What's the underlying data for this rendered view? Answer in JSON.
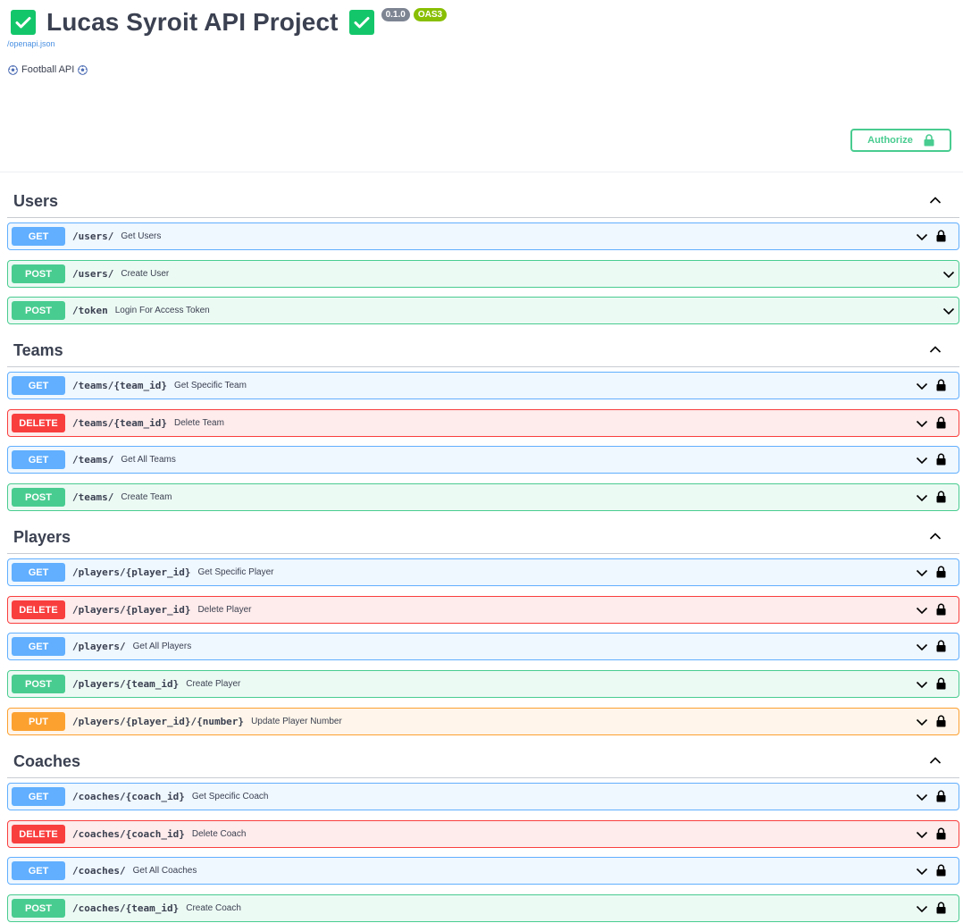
{
  "info": {
    "title": "Lucas Syroit API Project",
    "version_badge": "0.1.0",
    "oas_badge": "OAS3",
    "spec_link": "/openapi.json",
    "description": "Football API"
  },
  "authorize": {
    "label": "Authorize"
  },
  "colors": {
    "get": "#61affe",
    "post": "#49cc90",
    "delete": "#f93e3e",
    "put": "#fca130",
    "check": "#14c66a"
  },
  "tags": [
    {
      "name": "Users",
      "operations": [
        {
          "method": "GET",
          "path": "/users/",
          "summary": "Get Users",
          "locked": true
        },
        {
          "method": "POST",
          "path": "/users/",
          "summary": "Create User",
          "locked": false
        },
        {
          "method": "POST",
          "path": "/token",
          "summary": "Login For Access Token",
          "locked": false
        }
      ]
    },
    {
      "name": "Teams",
      "operations": [
        {
          "method": "GET",
          "path": "/teams/{team_id}",
          "summary": "Get Specific Team",
          "locked": true
        },
        {
          "method": "DELETE",
          "path": "/teams/{team_id}",
          "summary": "Delete Team",
          "locked": true
        },
        {
          "method": "GET",
          "path": "/teams/",
          "summary": "Get All Teams",
          "locked": true
        },
        {
          "method": "POST",
          "path": "/teams/",
          "summary": "Create Team",
          "locked": true
        }
      ]
    },
    {
      "name": "Players",
      "operations": [
        {
          "method": "GET",
          "path": "/players/{player_id}",
          "summary": "Get Specific Player",
          "locked": true
        },
        {
          "method": "DELETE",
          "path": "/players/{player_id}",
          "summary": "Delete Player",
          "locked": true
        },
        {
          "method": "GET",
          "path": "/players/",
          "summary": "Get All Players",
          "locked": true
        },
        {
          "method": "POST",
          "path": "/players/{team_id}",
          "summary": "Create Player",
          "locked": true
        },
        {
          "method": "PUT",
          "path": "/players/{player_id}/{number}",
          "summary": "Update Player Number",
          "locked": true
        }
      ]
    },
    {
      "name": "Coaches",
      "operations": [
        {
          "method": "GET",
          "path": "/coaches/{coach_id}",
          "summary": "Get Specific Coach",
          "locked": true
        },
        {
          "method": "DELETE",
          "path": "/coaches/{coach_id}",
          "summary": "Delete Coach",
          "locked": true
        },
        {
          "method": "GET",
          "path": "/coaches/",
          "summary": "Get All Coaches",
          "locked": true
        },
        {
          "method": "POST",
          "path": "/coaches/{team_id}",
          "summary": "Create Coach",
          "locked": true
        }
      ]
    }
  ]
}
